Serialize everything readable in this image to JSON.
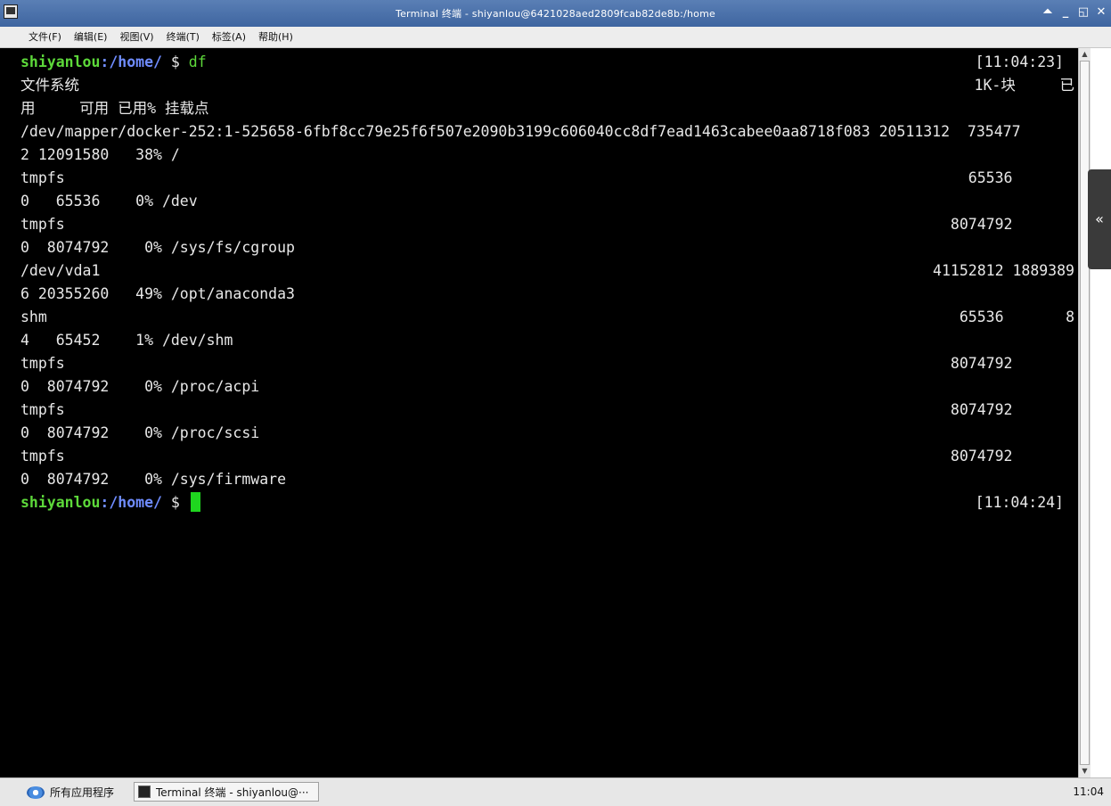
{
  "window": {
    "title": "Terminal 终端 - shiyanlou@6421028aed2809fcab82de8b:/home",
    "controls": [
      "⏶",
      "_",
      "◱",
      "✕"
    ]
  },
  "menubar": {
    "items": [
      "文件(F)",
      "编辑(E)",
      "视图(V)",
      "终端(T)",
      "标签(A)",
      "帮助(H)"
    ]
  },
  "terminal": {
    "prompt1": {
      "user": "shiyanlou",
      "path": ":/home/",
      "dollar": " $ ",
      "command": "df",
      "time": "[11:04:23]"
    },
    "lines": [
      {
        "left": "文件系统",
        "right": "1K-块     已"
      },
      {
        "left": "用     可用 已用% 挂载点",
        "right": ""
      },
      {
        "left": "/dev/mapper/docker-252:1-525658-6fbf8cc79e25f6f507e2090b3199c606040cc8df7ead1463cabee0aa8718f083 20511312  735477",
        "right": ""
      },
      {
        "left": "2 12091580   38% /",
        "right": ""
      },
      {
        "left": "tmpfs",
        "right": "65536       "
      },
      {
        "left": "0   65536    0% /dev",
        "right": ""
      },
      {
        "left": "tmpfs",
        "right": "8074792       "
      },
      {
        "left": "0  8074792    0% /sys/fs/cgroup",
        "right": ""
      },
      {
        "left": "/dev/vda1",
        "right": "41152812 1889389"
      },
      {
        "left": "6 20355260   49% /opt/anaconda3",
        "right": ""
      },
      {
        "left": "shm",
        "right": "65536       8"
      },
      {
        "left": "4   65452    1% /dev/shm",
        "right": ""
      },
      {
        "left": "tmpfs",
        "right": "8074792       "
      },
      {
        "left": "0  8074792    0% /proc/acpi",
        "right": ""
      },
      {
        "left": "tmpfs",
        "right": "8074792       "
      },
      {
        "left": "0  8074792    0% /proc/scsi",
        "right": ""
      },
      {
        "left": "tmpfs",
        "right": "8074792       "
      },
      {
        "left": "0  8074792    0% /sys/firmware",
        "right": ""
      }
    ],
    "prompt2": {
      "user": "shiyanlou",
      "path": ":/home/",
      "dollar": " $ ",
      "time": "[11:04:24]"
    }
  },
  "sidebar_toggle": "«",
  "taskbar": {
    "start_label": "所有应用程序",
    "task_label": "Terminal 终端 - shiyanlou@···",
    "clock": "11:04"
  }
}
